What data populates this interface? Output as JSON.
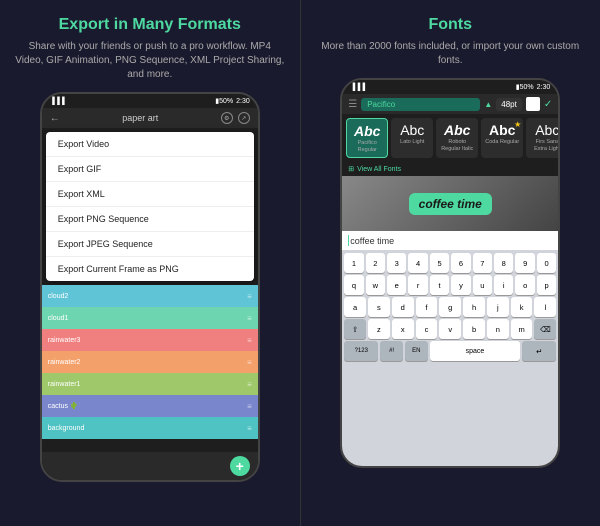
{
  "left_panel": {
    "title": "Export in Many Formats",
    "description": "Share with your friends or push to a pro workflow. MP4 Video, GIF Animation, PNG Sequence, XML Project Sharing, and more.",
    "topbar": {
      "back_icon": "←",
      "title": "paper art",
      "settings_icon": "⚙",
      "share_icon": "↗"
    },
    "export_menu": [
      "Export Video",
      "Export GIF",
      "Export XML",
      "Export PNG Sequence",
      "Export JPEG Sequence",
      "Export Current Frame as PNG"
    ],
    "layers": [
      {
        "name": "cloud2",
        "color": "#5ec4d6"
      },
      {
        "name": "cloud1",
        "color": "#6dd6b0"
      },
      {
        "name": "rainwater3",
        "color": "#f08080"
      },
      {
        "name": "rainwater2",
        "color": "#f4a06a"
      },
      {
        "name": "rainwater1",
        "color": "#9ec86a"
      },
      {
        "name": "cactus",
        "color": "#7986cb"
      },
      {
        "name": "background",
        "color": "#4fc3c3"
      }
    ],
    "fab_icon": "+"
  },
  "right_panel": {
    "title": "Fonts",
    "description": "More than 2000 fonts included, or import your own custom fonts.",
    "topbar": {
      "font_name": "Pacifico",
      "font_size": "48pt",
      "checkmark": "✓"
    },
    "fonts": [
      {
        "preview": "Abc",
        "label": "Pacifico Regular",
        "selected": true
      },
      {
        "preview": "Abc",
        "label": "Lato Light",
        "selected": false
      },
      {
        "preview": "Abc",
        "label": "Roboto Regular Italic",
        "selected": false
      },
      {
        "preview": "Abc",
        "label": "Coda Regular",
        "star": true,
        "selected": false
      },
      {
        "preview": "Abc",
        "label": "Firs Sans Extra Light",
        "selected": false
      }
    ],
    "view_all_fonts": "View All Fonts",
    "preview_text": "coffee time",
    "input_text": "coffee time",
    "keyboard_rows": [
      [
        "1",
        "2",
        "3",
        "4",
        "5",
        "6",
        "7",
        "8",
        "9",
        "0"
      ],
      [
        "q",
        "w",
        "e",
        "r",
        "t",
        "y",
        "u",
        "i",
        "o",
        "p"
      ],
      [
        "a",
        "s",
        "d",
        "f",
        "g",
        "h",
        "j",
        "k",
        "l"
      ],
      [
        "⇧",
        "z",
        "x",
        "c",
        "v",
        "b",
        "n",
        "m",
        "⌫"
      ],
      [
        "?123",
        "#!",
        "EN",
        "space",
        "↵"
      ]
    ]
  },
  "status_bar": {
    "battery": "50%",
    "time": "2:30"
  }
}
